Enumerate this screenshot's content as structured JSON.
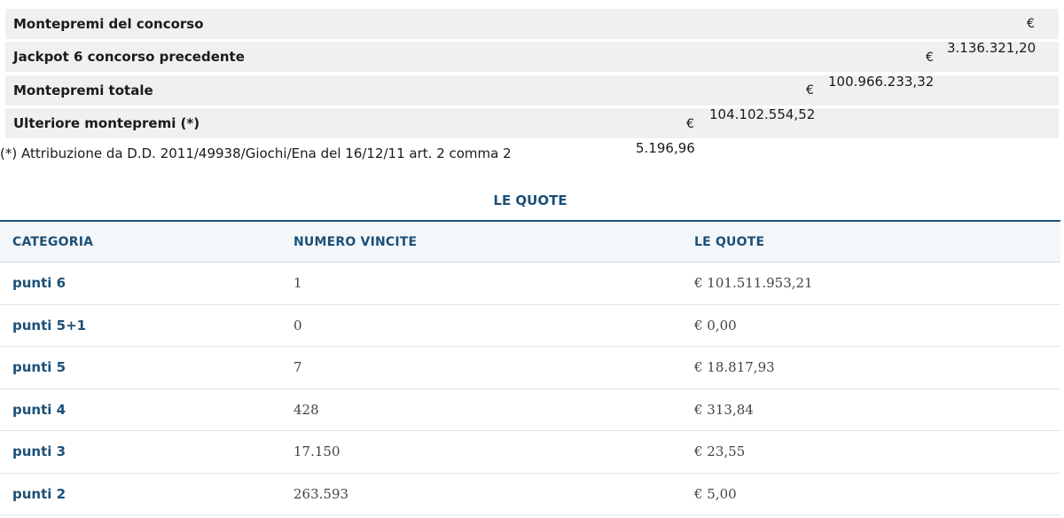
{
  "summary": {
    "rows": [
      {
        "label": "Montepremi del concorso",
        "currency": "€",
        "amount": "3.136.321,20"
      },
      {
        "label": "Jackpot 6 concorso precedente",
        "currency": "€",
        "amount": "100.966.233,32"
      },
      {
        "label": "Montepremi totale",
        "currency": "€",
        "amount": "104.102.554,52"
      },
      {
        "label": "Ulteriore montepremi (*)",
        "currency": "€",
        "amount": "5.196,96"
      }
    ],
    "note": "(*) Attribuzione da D.D. 2011/49938/Giochi/Ena del 16/12/11 art. 2 comma 2"
  },
  "quote": {
    "title": "LE QUOTE",
    "headers": [
      "CATEGORIA",
      "NUMERO VINCITE",
      "LE QUOTE"
    ],
    "rows": [
      {
        "categoria": "punti 6",
        "vincite": "1",
        "quota": "€ 101.511.953,21"
      },
      {
        "categoria": "punti 5+1",
        "vincite": "0",
        "quota": "€ 0,00"
      },
      {
        "categoria": "punti 5",
        "vincite": "7",
        "quota": "€ 18.817,93"
      },
      {
        "categoria": "punti 4",
        "vincite": "428",
        "quota": "€ 313,84"
      },
      {
        "categoria": "punti 3",
        "vincite": "17.150",
        "quota": "€ 23,55"
      },
      {
        "categoria": "punti 2",
        "vincite": "263.593",
        "quota": "€ 5,00"
      }
    ]
  }
}
